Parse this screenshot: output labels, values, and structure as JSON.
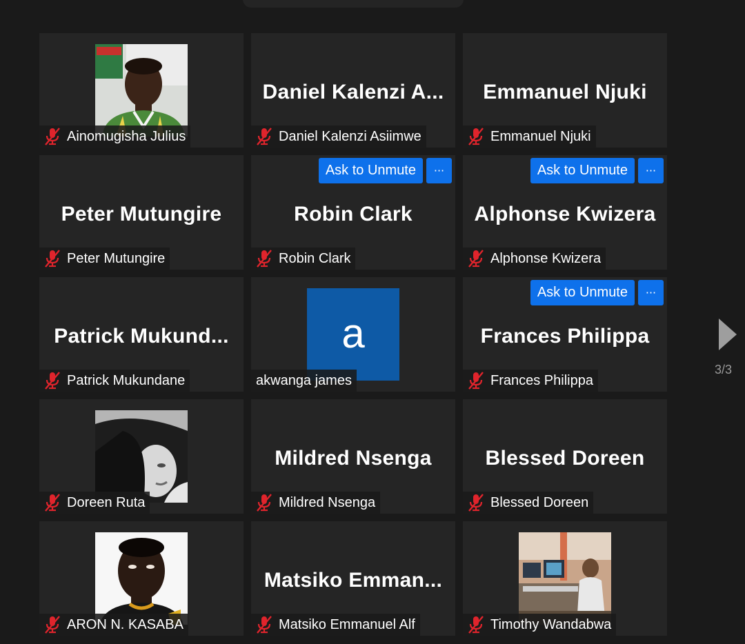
{
  "participants": [
    {
      "display": "",
      "tag": "Ainomugisha Julius",
      "muted": true,
      "type": "photo",
      "photo": "man-green-shirt"
    },
    {
      "display": "Daniel  Kalenzi  A...",
      "tag": "Daniel Kalenzi Asiimwe",
      "muted": true,
      "type": "name"
    },
    {
      "display": "Emmanuel Njuki",
      "tag": "Emmanuel Njuki",
      "muted": true,
      "type": "name"
    },
    {
      "display": "Peter Mutungire",
      "tag": "Peter Mutungire",
      "muted": true,
      "type": "name"
    },
    {
      "display": "Robin Clark",
      "tag": "Robin Clark",
      "muted": true,
      "type": "name",
      "ask_unmute": true
    },
    {
      "display": "Alphonse Kwizera",
      "tag": "Alphonse Kwizera",
      "muted": true,
      "type": "name",
      "ask_unmute": true
    },
    {
      "display": "Patrick  Mukund...",
      "tag": "Patrick Mukundane",
      "muted": true,
      "type": "name"
    },
    {
      "display": "",
      "tag": "akwanga james",
      "muted": false,
      "type": "avatar",
      "avatar_letter": "a"
    },
    {
      "display": "Frances Philippa",
      "tag": "Frances Philippa",
      "muted": true,
      "type": "name",
      "ask_unmute": true
    },
    {
      "display": "",
      "tag": "Doreen Ruta",
      "muted": true,
      "type": "photo",
      "photo": "woman-bw"
    },
    {
      "display": "Mildred Nsenga",
      "tag": "Mildred Nsenga",
      "muted": true,
      "type": "name"
    },
    {
      "display": "Blessed Doreen",
      "tag": "Blessed Doreen",
      "muted": true,
      "type": "name"
    },
    {
      "display": "",
      "tag": "ARON N. KASABA",
      "muted": true,
      "type": "photo",
      "photo": "man-white-bg"
    },
    {
      "display": "Matsiko  Emman...",
      "tag": "Matsiko Emmanuel Alf",
      "muted": true,
      "type": "name"
    },
    {
      "display": "",
      "tag": "Timothy Wandabwa",
      "muted": true,
      "type": "photo",
      "photo": "studio-scene"
    }
  ],
  "labels": {
    "ask_unmute": "Ask to Unmute",
    "more": "···"
  },
  "pagination": {
    "indicator": "3/3"
  },
  "colors": {
    "background": "#1a1a1a",
    "tile": "#252525",
    "button": "#0e71eb",
    "muted_icon": "#e0242c",
    "avatar": "#0e5aa6"
  }
}
